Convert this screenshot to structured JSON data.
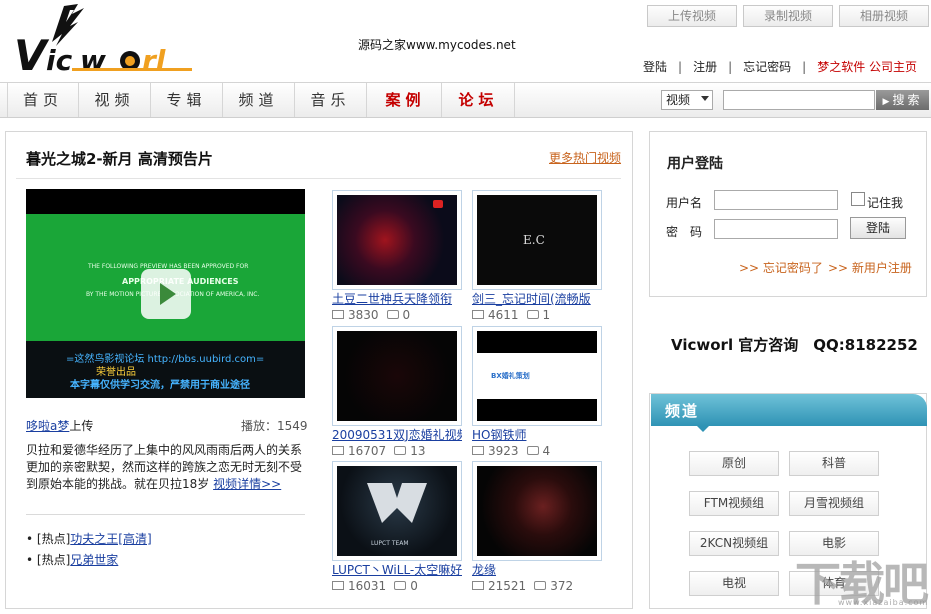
{
  "header": {
    "logo_text": "Vicworl",
    "center_text": "源码之家www.mycodes.net",
    "top_buttons": [
      "上传视频",
      "录制视频",
      "相册视频"
    ],
    "links": [
      "登陆",
      "注册",
      "忘记密码"
    ],
    "red_links": [
      "梦之软件",
      "公司主页"
    ]
  },
  "nav": {
    "items": [
      "首页",
      "视频",
      "专辑",
      "频道",
      "音乐",
      "案例",
      "论坛"
    ],
    "select_value": "视频",
    "search_button": "搜索"
  },
  "main": {
    "title": "暮光之城2-新月 高清预告片",
    "more_link": "更多热门视频",
    "player": {
      "lines": [
        "THE FOLLOWING PREVIEW HAS BEEN APPROVED FOR",
        "APPROPRIATE AUDIENCES",
        "BY THE MOTION PICTURE ASSOCIATION OF AMERICA, INC."
      ],
      "subtitle1": "=这然鸟影视论坛 http://bbs.uubird.com=",
      "subtitle2": "荣誉出品",
      "subtitle3": "本字幕仅供学习交流，严禁用于商业途径"
    },
    "uploader_name": "哆啦a梦",
    "uploader_suffix": "上传",
    "plays_label": "播放：",
    "plays_value": "1549",
    "description": "贝拉和爱德华经历了上集中的风风雨雨后两人的关系更加的亲密默契，然而这样的跨族之恋无时无刻不受到原始本能的挑战。就在贝拉18岁 ",
    "detail_link": "视频详情>>",
    "hot": [
      {
        "tag": "[热点]",
        "title": "功夫之王[高清]"
      },
      {
        "tag": "[热点]",
        "title": "兄弟世家"
      }
    ],
    "videos": [
      {
        "title": "土豆二世神兵天降领衔",
        "views": "3830",
        "comments": "0"
      },
      {
        "title": "剑三_忘记时间(流畅版",
        "views": "4611",
        "comments": "1"
      },
      {
        "title": "20090531双J恋婚礼视频",
        "views": "16707",
        "comments": "13"
      },
      {
        "title": "HO钢铁师",
        "views": "3923",
        "comments": "4"
      },
      {
        "title": "LUPCT丶WiLL-太空嘛好",
        "views": "16031",
        "comments": "0"
      },
      {
        "title": "龙缘",
        "views": "21521",
        "comments": "372"
      }
    ],
    "thumb_texts": {
      "ec": "E.C",
      "lupct": "LUPCT TEAM",
      "bx": "BX婚礼策划"
    }
  },
  "login": {
    "title": "用户登陆",
    "username_label": "用户名",
    "password_label": "密　码",
    "remember": "记住我",
    "login_button": "登陆",
    "forgot": ">> 忘记密码了",
    "register": ">> 新用户注册"
  },
  "consult": "Vicworl 官方咨询　QQ:8182252",
  "channel": {
    "title": "频道",
    "buttons": [
      "原创",
      "科普",
      "FTM视频组",
      "月雪视频组",
      "2KCN视频组",
      "电影",
      "电视",
      "体育"
    ]
  },
  "watermark": {
    "text": "下载吧",
    "sub": "www.xiazaiba.com"
  },
  "colors": {
    "accent_red": "#c40000",
    "link_orange": "#c8641e",
    "channel_blue": "#2f93b5"
  }
}
